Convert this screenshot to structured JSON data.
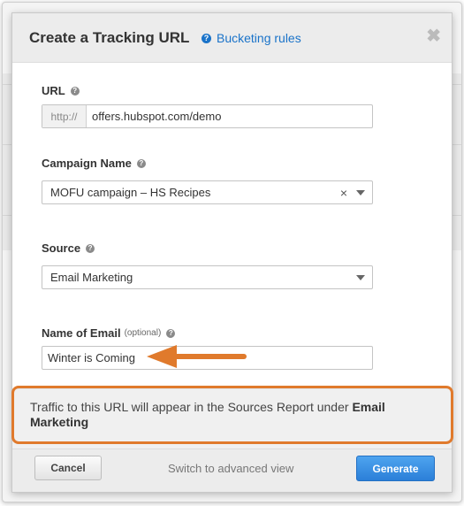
{
  "dialog": {
    "title": "Create a Tracking URL",
    "help_link": "Bucketing rules",
    "close_glyph": "✖"
  },
  "url": {
    "label": "URL",
    "prefix": "http://",
    "value": "offers.hubspot.com/demo"
  },
  "campaign": {
    "label": "Campaign Name",
    "value": "MOFU campaign – HS Recipes"
  },
  "source": {
    "label": "Source",
    "value": "Email Marketing"
  },
  "email_name": {
    "label": "Name of Email",
    "optional": "(optional)",
    "value": "Winter is Coming"
  },
  "notice": {
    "text": "Traffic to this URL will appear in the Sources Report under ",
    "emphasis": "Email Marketing"
  },
  "footer": {
    "cancel": "Cancel",
    "advanced": "Switch to advanced view",
    "generate": "Generate"
  },
  "colors": {
    "accent_blue": "#1a73c9",
    "annotation_orange": "#e07a2c",
    "primary_button": "#2b7fd8"
  },
  "icons": [
    "help-icon",
    "close-icon",
    "clear-icon",
    "dropdown-caret-icon",
    "annotation-arrow"
  ]
}
